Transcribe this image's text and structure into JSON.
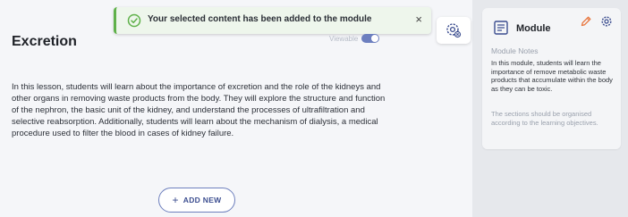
{
  "toast": {
    "message": "Your selected content has been added to the module",
    "close_glyph": "×",
    "icon": "check-circle-icon",
    "accent_color": "#5fb14a"
  },
  "lesson": {
    "title": "Excretion",
    "viewable_label": "Viewable",
    "viewable_on": true,
    "body": "In this lesson, students will learn about the importance of excretion and the role of the kidneys and other organs in removing waste products from the body. They will explore the structure and function of the nephron, the basic unit of the kidney, and understand the processes of ultrafiltration and selective reabsorption. Additionally, students will learn about the mechanism of dialysis, a medical procedure used to filter the blood in cases of kidney failure."
  },
  "settings_button": {
    "icon": "gear-settings-icon"
  },
  "add_new": {
    "plus": "+",
    "label": "ADD NEW"
  },
  "module": {
    "title": "Module",
    "notes_label": "Module Notes",
    "notes_text": "In this module, students will learn the importance of remove metabolic waste products that accumulate within the body as they can be toxic.",
    "notes_more": "The sections should be organised according to the learning objectives.",
    "icons": [
      "module-book-icon",
      "pencil-icon",
      "gear-icon"
    ],
    "accent_color": "#e8743b"
  }
}
